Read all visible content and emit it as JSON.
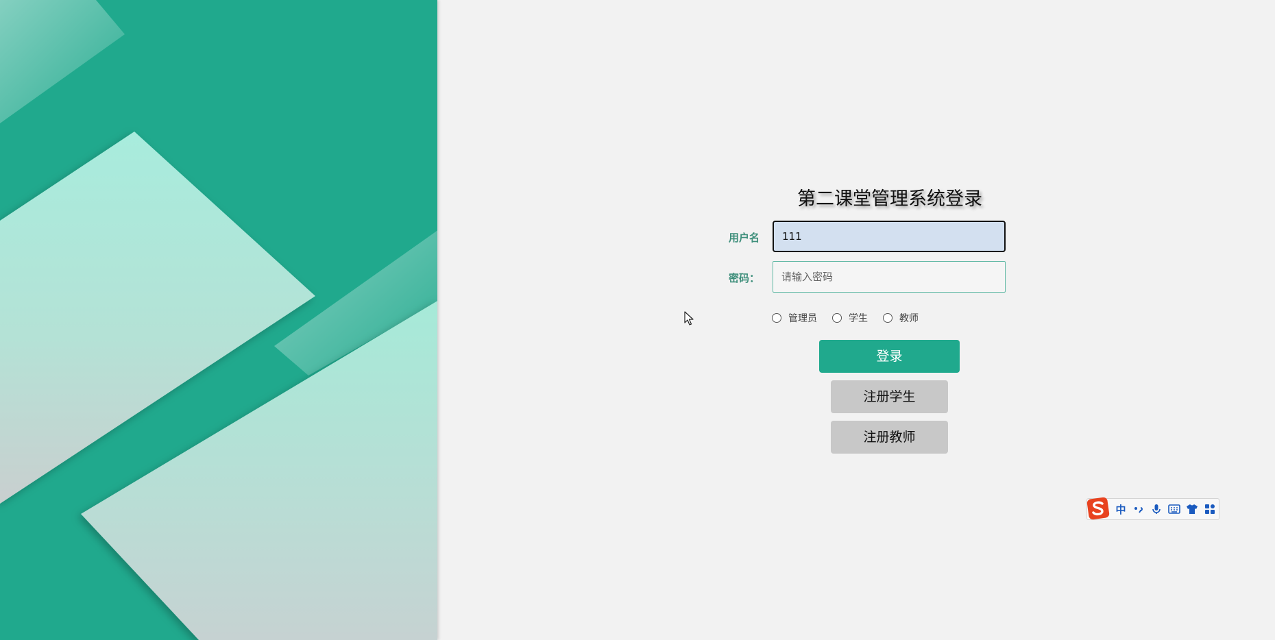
{
  "login": {
    "title": "第二课堂管理系统登录",
    "username_label": "用户名",
    "username_value": "111",
    "password_label": "密码：",
    "password_placeholder": "请输入密码",
    "roles": [
      "管理员",
      "学生",
      "教师"
    ],
    "login_button": "登录",
    "register_student_button": "注册学生",
    "register_teacher_button": "注册教师"
  },
  "ime_toolbar": {
    "mode_label": "中",
    "icons": [
      "sogou-logo-icon",
      "punctuation-icon",
      "microphone-icon",
      "keyboard-icon",
      "skin-shirt-icon",
      "toolbox-grid-icon"
    ]
  },
  "colors": {
    "accent": "#20a98d",
    "background": "#f2f2f2",
    "secondary_button": "#c8c8c8",
    "input_focus_bg": "#d3e0f0"
  }
}
